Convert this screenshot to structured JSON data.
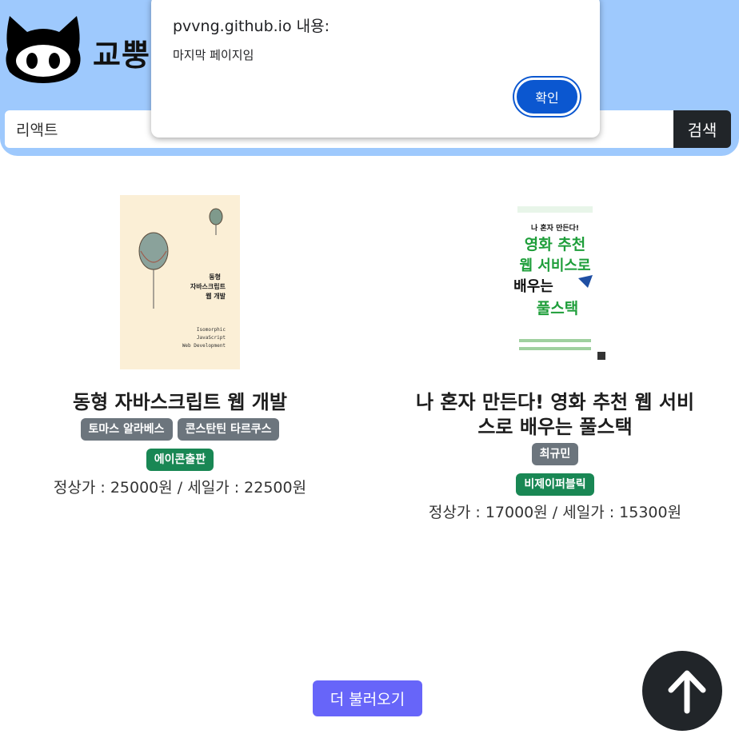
{
  "header": {
    "brand": "교뿡",
    "search_value": "리액트",
    "search_button": "검색"
  },
  "books": [
    {
      "title": "동형 자바스크립트 웹 개발",
      "authors": [
        "토마스 알라베스",
        "콘스탄틴 타르쿠스"
      ],
      "publisher": "에이콘출판",
      "price_text": "정상가 : 25000원 / 세일가 : 22500원"
    },
    {
      "title": "나 혼자 만든다! 영화 추천 웹 서비스로 배우는 풀스택",
      "authors": [
        "최규민"
      ],
      "publisher": "비제이퍼블릭",
      "price_text": "정상가 : 17000원 / 세일가 : 15300원"
    }
  ],
  "covers": {
    "cover1_lines": [
      "동형",
      "자바스크립트",
      "웹 개발",
      "Isomorphic",
      "JavaScript",
      "Web Development"
    ],
    "cover2_lines": [
      "나 혼자 만든다!",
      "영화 추천",
      "웹 서비스로",
      "배우는",
      "풀스택"
    ]
  },
  "more_button": "더 불러오기",
  "alert": {
    "title": "pvvng.github.io 내용:",
    "message": "마지막 페이지임",
    "ok_label": "확인"
  },
  "icons": {
    "logo": "github-octocat-icon",
    "scroll_top": "arrow-up-icon"
  },
  "colors": {
    "header_bg": "#9ec9fd",
    "author_badge": "#6c757d",
    "publisher_badge": "#198754",
    "more_button": "#6765f9",
    "alert_button": "#0b57d0"
  }
}
